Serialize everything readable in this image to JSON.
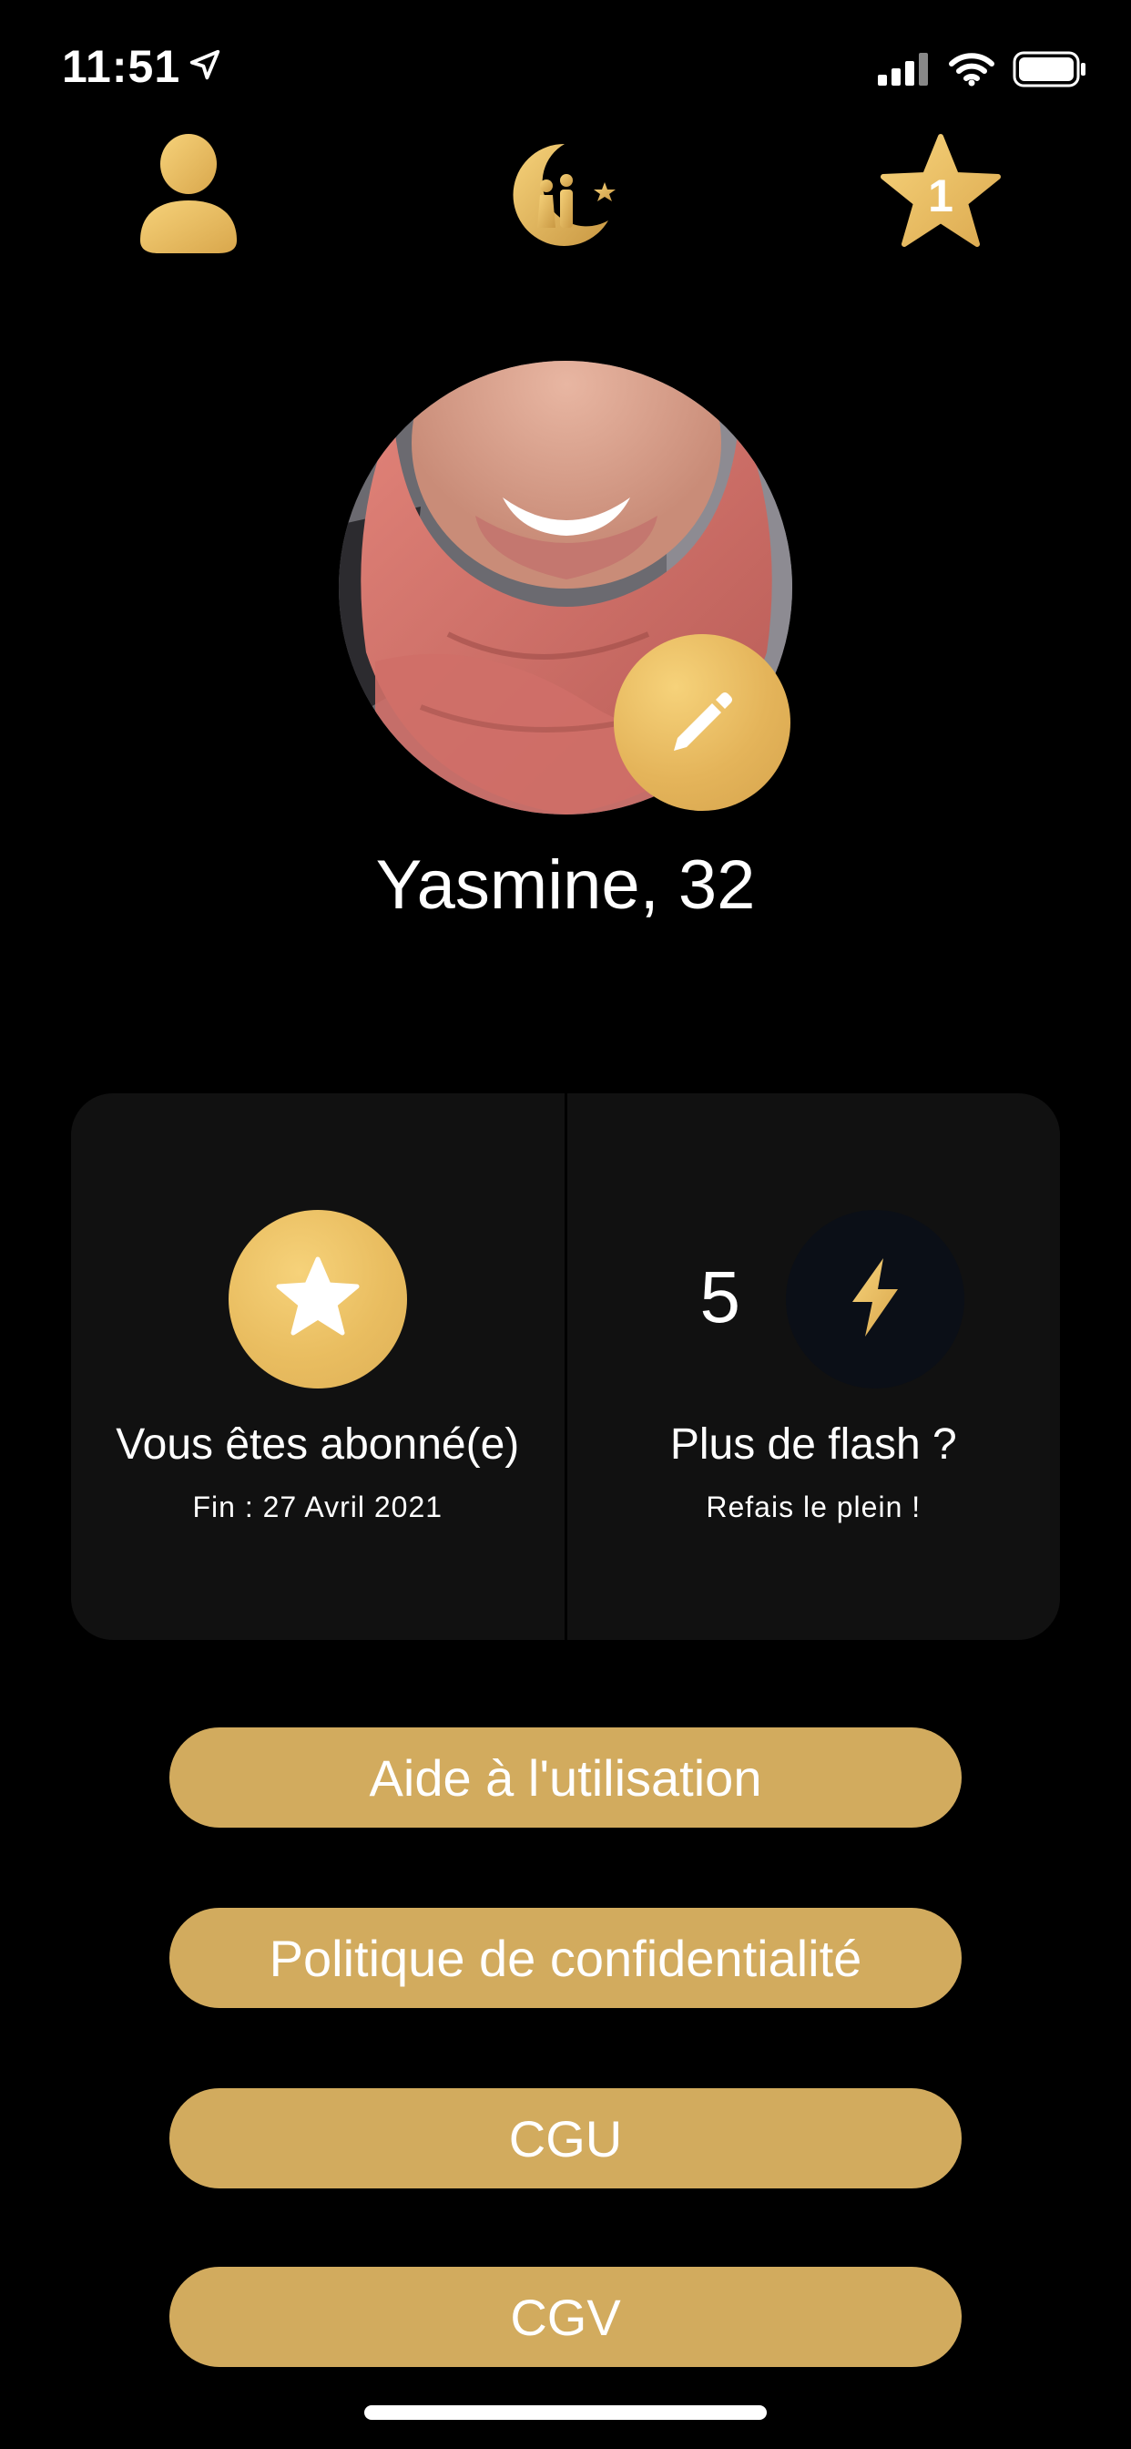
{
  "status_bar": {
    "time": "11:51",
    "location_icon": "location-arrow-icon",
    "signal_icon": "cellular-signal-icon",
    "wifi_icon": "wifi-icon",
    "battery_icon": "battery-icon"
  },
  "nav": {
    "profile_icon": "user-icon",
    "logo_icon": "crescent-couple-logo-icon",
    "favorites_icon": "star-icon",
    "favorites_count": "1"
  },
  "profile": {
    "name_age": "Yasmine, 32",
    "edit_icon": "pencil-icon"
  },
  "cards": {
    "subscription": {
      "icon": "star-icon",
      "title": "Vous êtes abonné(e)",
      "subtitle": "Fin : 27 Avril 2021"
    },
    "flash": {
      "count": "5",
      "icon": "lightning-icon",
      "title": "Plus de flash ?",
      "subtitle": "Refais le plein !"
    }
  },
  "buttons": {
    "help": "Aide à l'utilisation",
    "privacy": "Politique de confidentialité",
    "cgu": "CGU",
    "cgv": "CGV"
  },
  "colors": {
    "background": "#000000",
    "gold": "#d2ab5e",
    "card": "#111111"
  }
}
